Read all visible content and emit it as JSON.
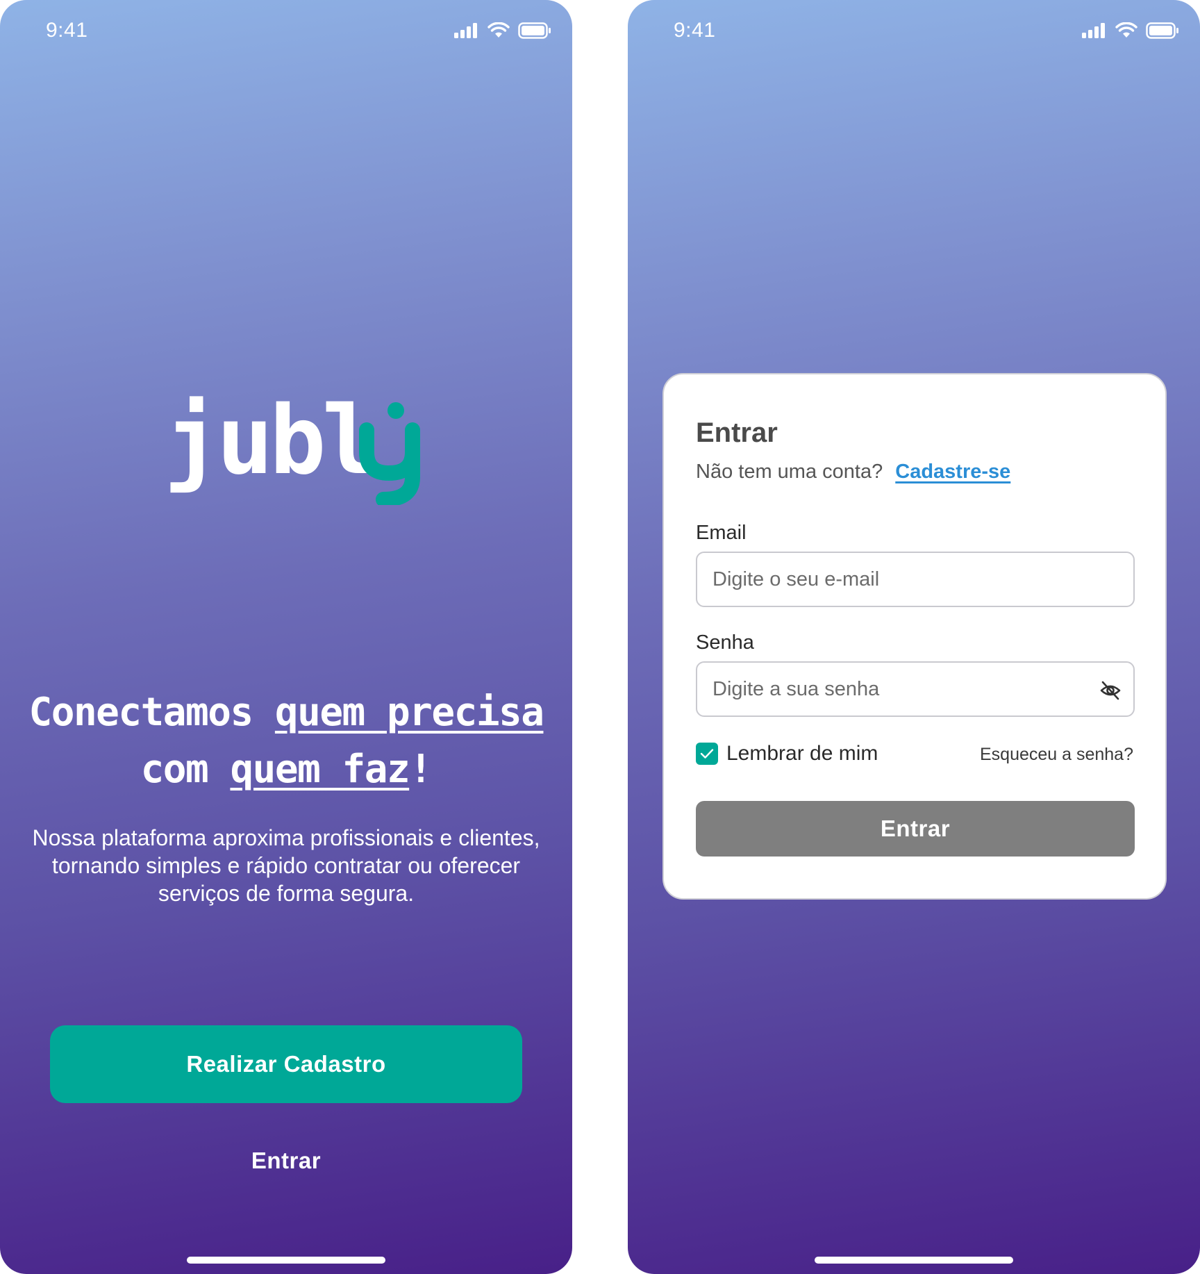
{
  "status_bar": {
    "time": "9:41"
  },
  "welcome": {
    "logo_text": "jubl",
    "logo_letter": "y",
    "headline": {
      "part1": "Conectamos ",
      "part2": "quem precisa",
      "part3": " com ",
      "part4": "quem faz",
      "part5": "!"
    },
    "description": "Nossa plataforma aproxima profissionais e clientes, tornando simples e rápido contratar ou oferecer serviços de forma segura.",
    "signup_button": "Realizar Cadastro",
    "login_link": "Entrar"
  },
  "login": {
    "title": "Entrar",
    "no_account_text": "Não tem uma conta?",
    "signup_link": "Cadastre-se",
    "email_label": "Email",
    "email_placeholder": "Digite o seu e-mail",
    "password_label": "Senha",
    "password_placeholder": "Digite a sua senha",
    "remember_label": "Lembrar de mim",
    "remember_checked": true,
    "forgot_link": "Esqueceu a senha?",
    "submit_button": "Entrar"
  },
  "colors": {
    "accent": "#00a897",
    "link": "#2b8ed6",
    "submit_disabled": "#7f7f7f"
  },
  "icons": [
    "signal-icon",
    "wifi-icon",
    "battery-icon",
    "eye-off-icon",
    "checkmark-icon"
  ]
}
